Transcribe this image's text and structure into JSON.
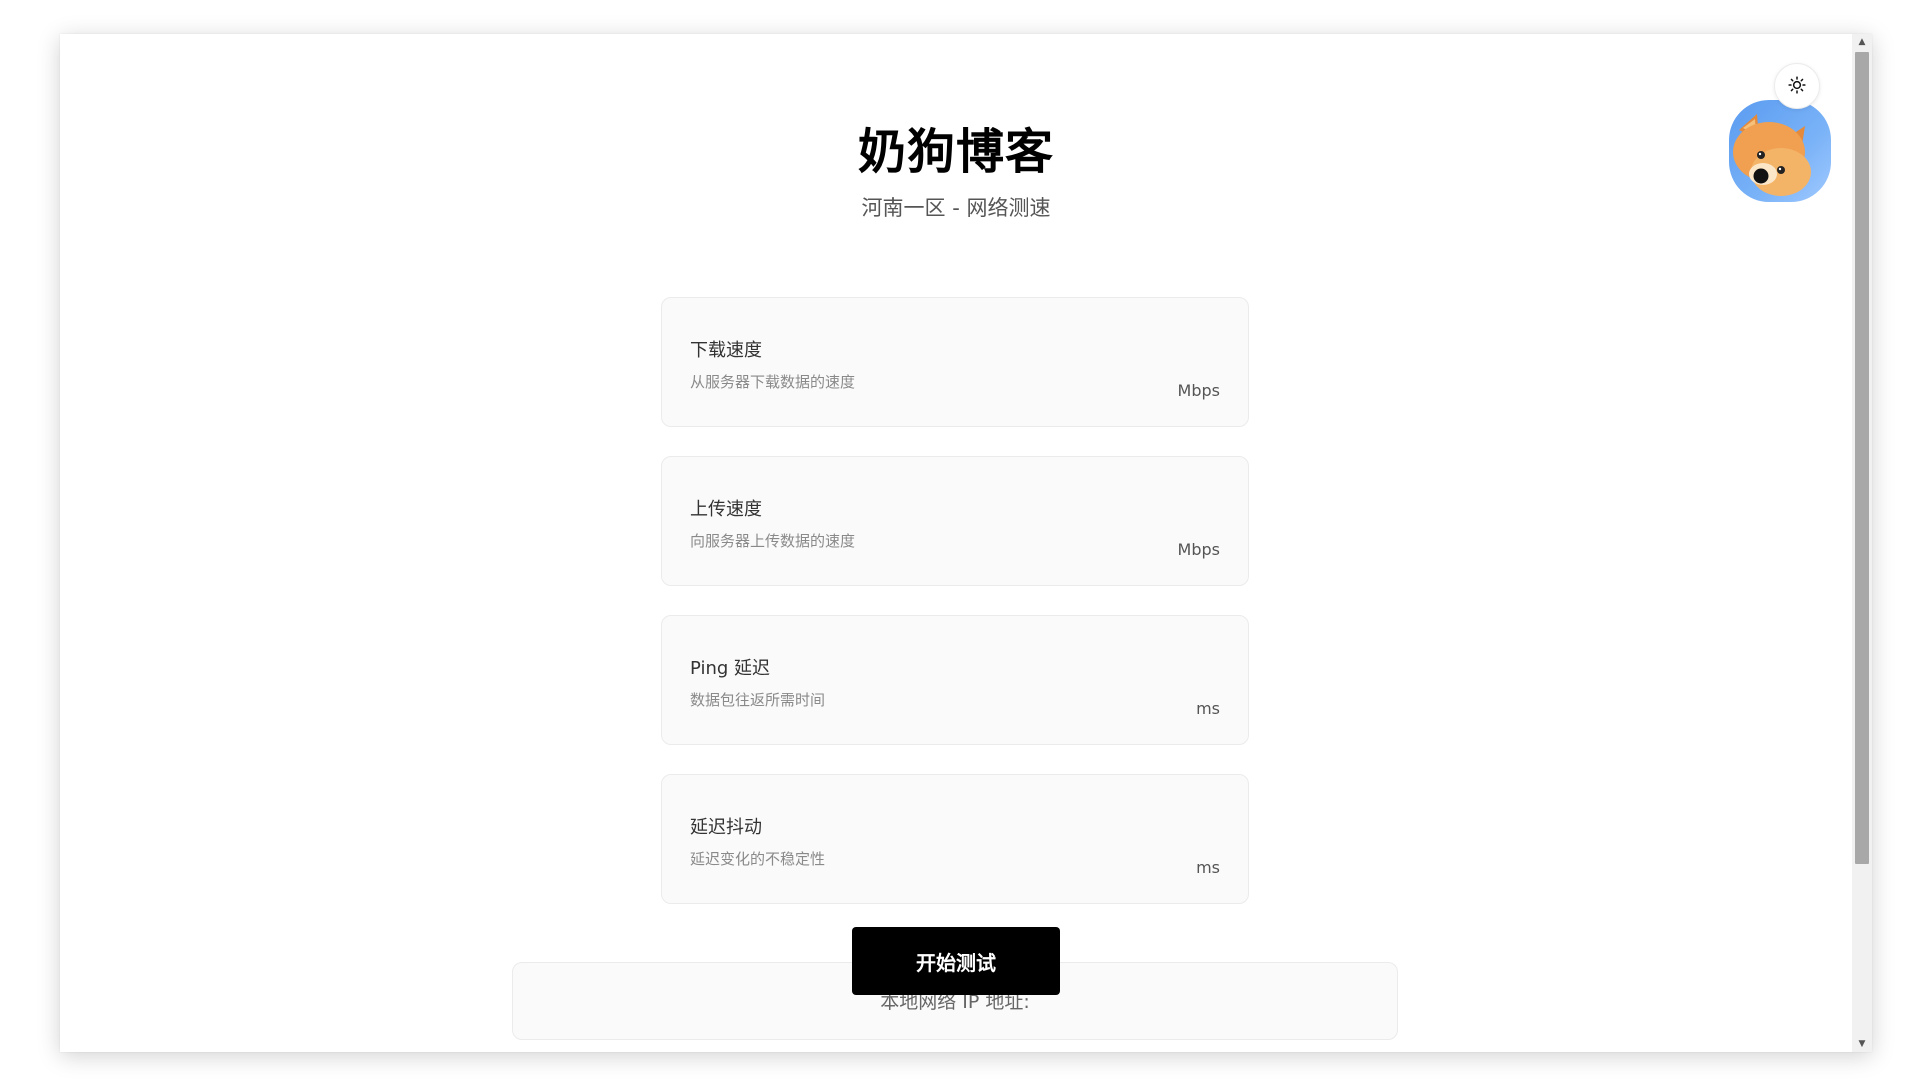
{
  "header": {
    "title": "奶狗博客",
    "subtitle": "河南一区 - 网络测速"
  },
  "controls": {
    "theme_icon": "sun-icon",
    "avatar_icon": "shiba-dog-avatar"
  },
  "metrics": [
    {
      "title": "下载速度",
      "description": "从服务器下载数据的速度",
      "unit": "Mbps"
    },
    {
      "title": "上传速度",
      "description": "向服务器上传数据的速度",
      "unit": "Mbps"
    },
    {
      "title": "Ping 延迟",
      "description": "数据包往返所需时间",
      "unit": "ms"
    },
    {
      "title": "延迟抖动",
      "description": "延迟变化的不稳定性",
      "unit": "ms"
    }
  ],
  "actions": {
    "start_label": "开始测试"
  },
  "ip": {
    "label": "本地网络 IP 地址:"
  },
  "colors": {
    "button_bg": "#000000",
    "card_bg": "#fafafa",
    "avatar_bg": "#5a9bf0"
  }
}
